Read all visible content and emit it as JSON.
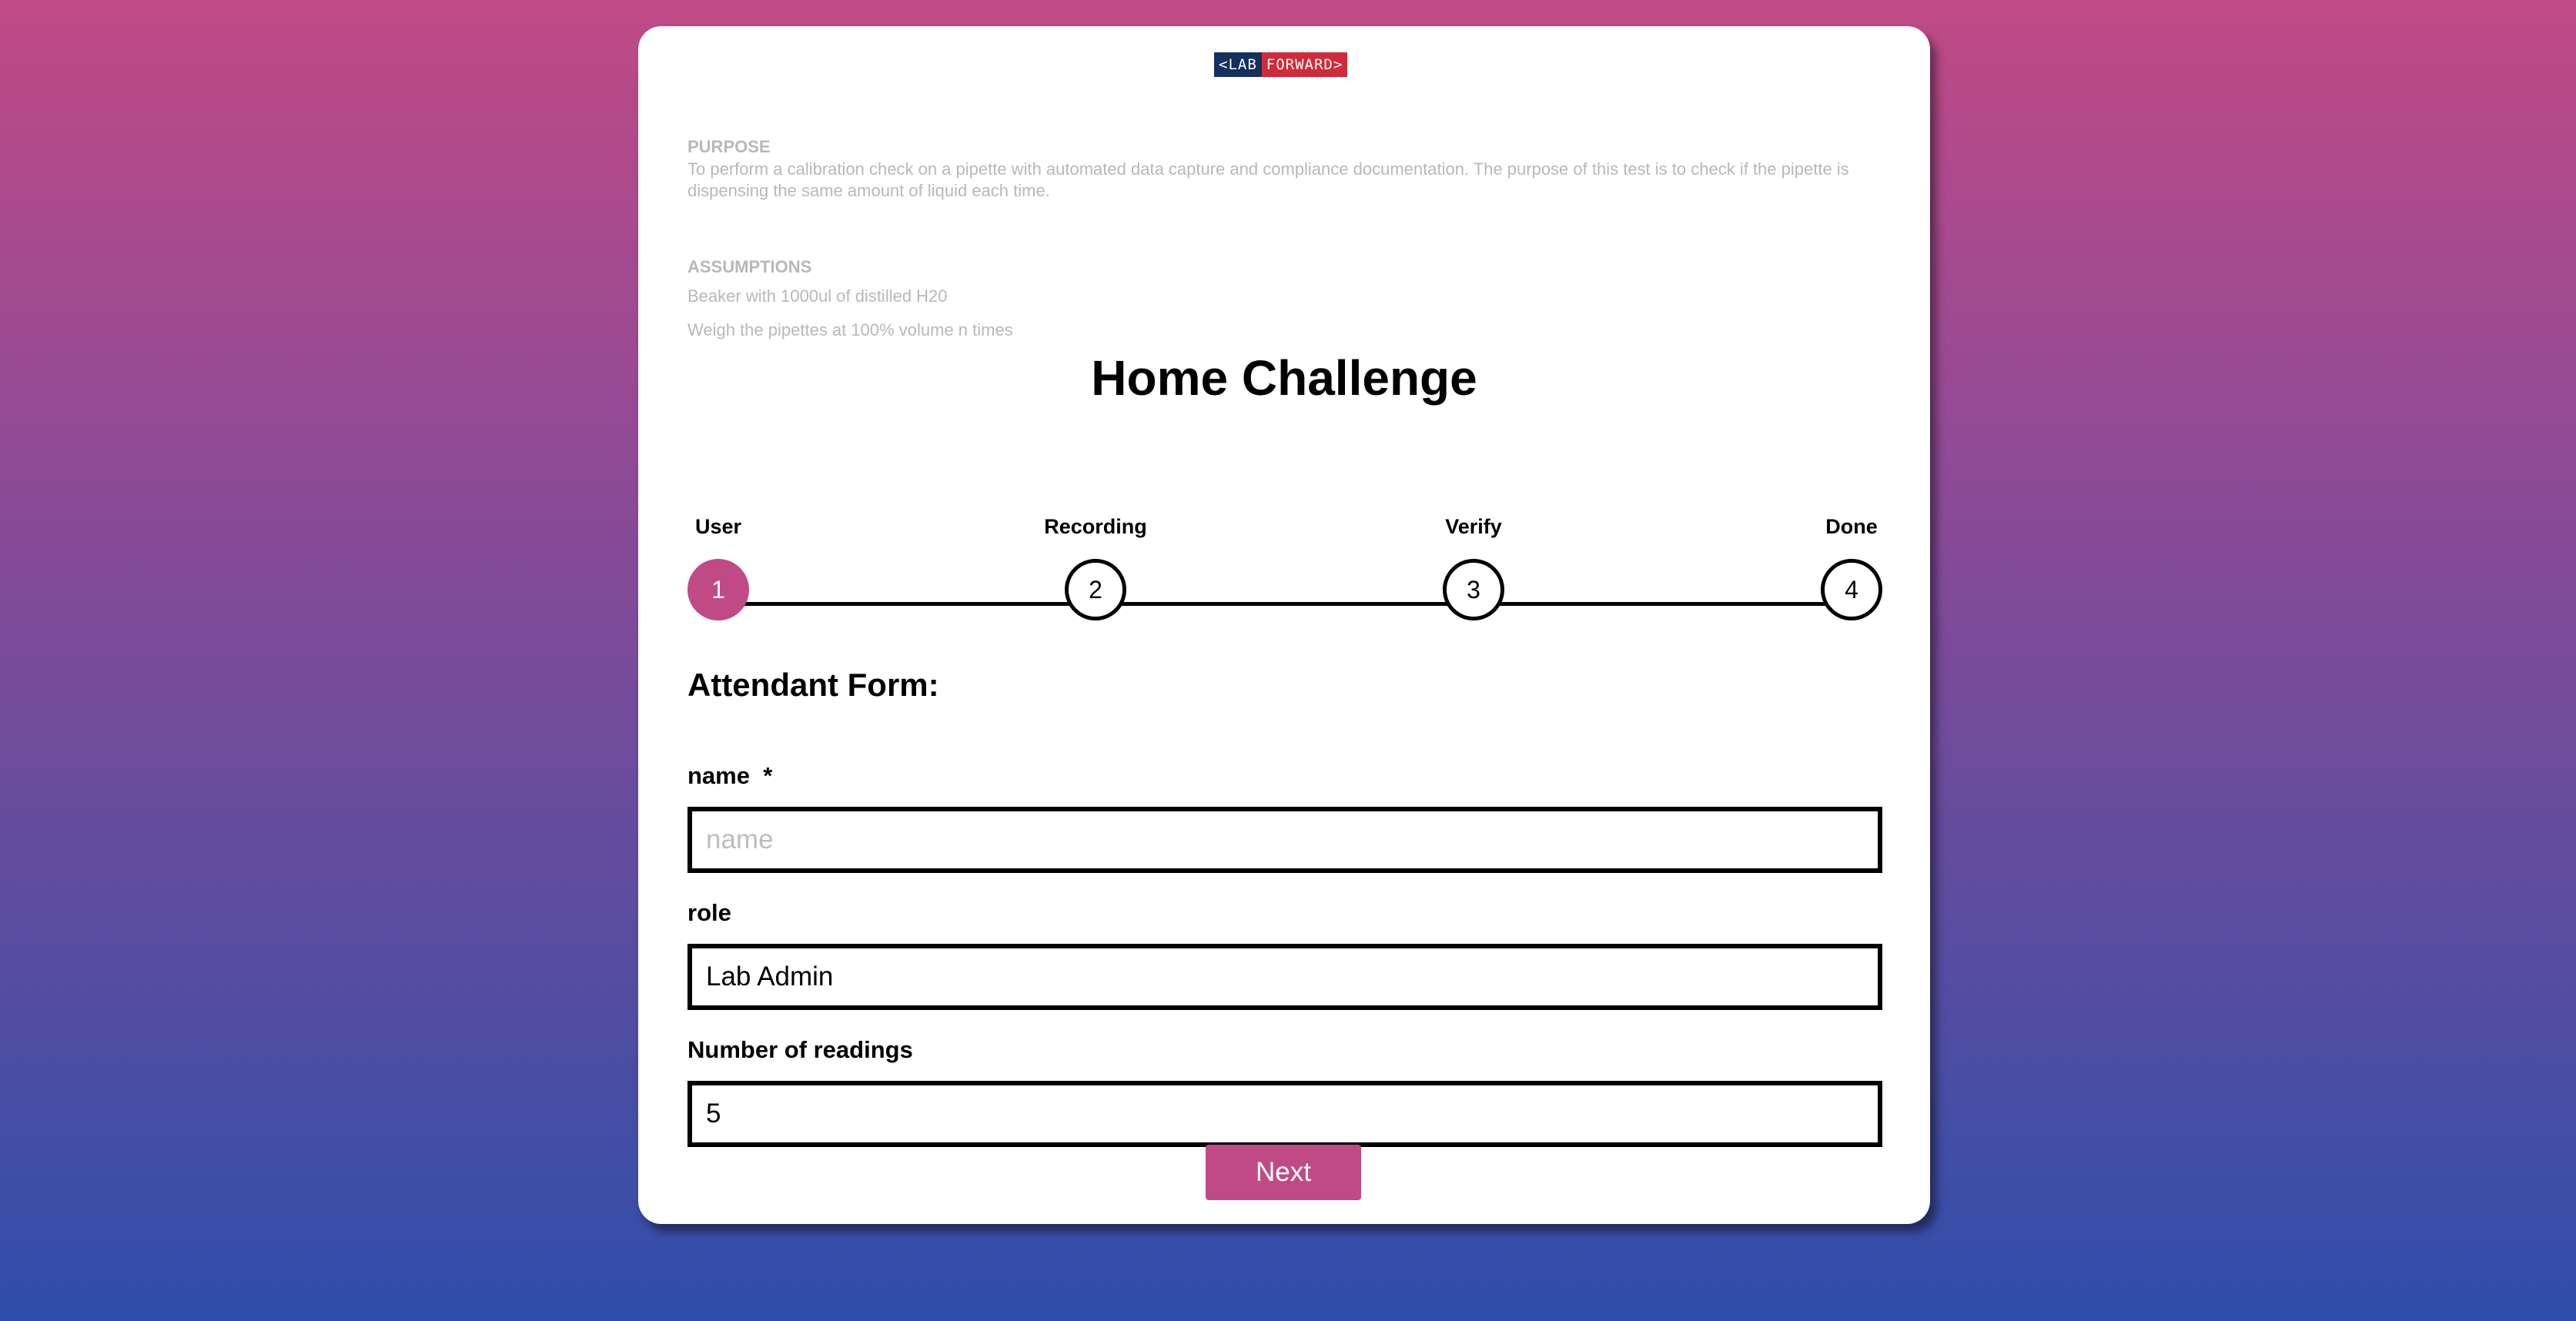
{
  "brand": {
    "logo_left": "<LAB",
    "logo_right": "FORWARD>"
  },
  "purpose": {
    "heading": "PURPOSE",
    "text": "To perform a calibration check on a pipette with automated data capture and compliance documentation. The purpose of this test is to check if the pipette is dispensing the same amount of liquid each time."
  },
  "assumptions": {
    "heading": "ASSUMPTIONS",
    "items": [
      "Beaker with 1000ul of distilled H20",
      "Weigh the pipettes at 100% volume n times"
    ]
  },
  "title": "Home Challenge",
  "stepper": {
    "steps": [
      {
        "label": "User",
        "number": "1",
        "active": true
      },
      {
        "label": "Recording",
        "number": "2",
        "active": false
      },
      {
        "label": "Verify",
        "number": "3",
        "active": false
      },
      {
        "label": "Done",
        "number": "4",
        "active": false
      }
    ]
  },
  "form": {
    "title": "Attendant Form:",
    "name": {
      "label": "name  *",
      "placeholder": "name",
      "value": ""
    },
    "role": {
      "label": "role",
      "value": "Lab Admin"
    },
    "readings": {
      "label": "Number of readings",
      "value": "5"
    },
    "next_label": "Next"
  },
  "colors": {
    "accent": "#c04a86",
    "logo_navy": "#13305e",
    "logo_red": "#d12a3a"
  }
}
